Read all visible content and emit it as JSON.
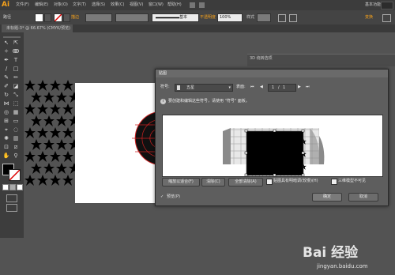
{
  "app": {
    "logo": "Ai"
  },
  "menubar": {
    "items": [
      "文件(F)",
      "编辑(E)",
      "对象(O)",
      "文字(T)",
      "选择(S)",
      "效果(C)",
      "视图(V)",
      "窗口(W)",
      "帮助(H)"
    ],
    "workspace": "基本功能"
  },
  "control_bar": {
    "mode": "路径",
    "stroke_label": "描边",
    "stroke_style": "基本",
    "opacity_label": "不透明度",
    "opacity_value": "100%",
    "style_label": "样式",
    "transform_label": "变换"
  },
  "document": {
    "tab": "未标题-3* @ 66.67% (CMYK/预览)"
  },
  "panel3d": {
    "title": "3D 绕转选项"
  },
  "dialog": {
    "title": "贴图",
    "symbol_label": "符号:",
    "symbol_value": "五星",
    "surface_label": "表面:",
    "surface_value": "1",
    "surface_total": "1",
    "hint": "要创建和编辑这些符号，请使用 \"符号\" 面板。",
    "buttons": {
      "scale_to_fit": "缩放以适合(F)",
      "clear": "清除(C)",
      "clear_all": "全部清除(A)",
      "ok": "确定",
      "cancel": "取消"
    },
    "checks": {
      "shade_artwork": "贴图具有明暗调(较慢)(H)",
      "invisible_geometry": "三维模型不可见",
      "preview": "预览(P)"
    }
  },
  "watermark": {
    "brand": "Bai 经验",
    "url": "jingyan.baidu.com"
  },
  "colors": {
    "accent": "#f7a21b",
    "selection": "#f0b400",
    "sphere": "#cc2222"
  }
}
